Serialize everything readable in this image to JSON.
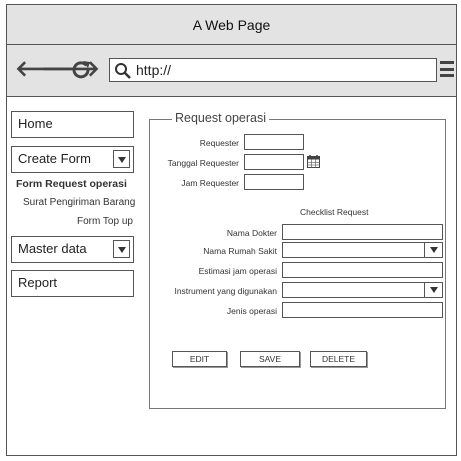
{
  "window": {
    "title": "A Web Page"
  },
  "toolbar": {
    "back_icon": "back-arrow-icon",
    "forward_icon": "forward-arrow-icon",
    "reload_icon": "reload-icon",
    "url": "http://",
    "menu_icon": "hamburger-menu-icon"
  },
  "sidebar": {
    "home": "Home",
    "create_form": "Create Form",
    "create_form_items": [
      "Form Request operasi",
      "Surat Pengiriman Barang",
      "Form Top up"
    ],
    "master_data": "Master data",
    "report": "Report"
  },
  "form": {
    "legend": "Request operasi",
    "requester_label": "Requester",
    "requester_value": "",
    "tanggal_label": "Tanggal Requester",
    "tanggal_value": "",
    "jam_label": "Jam Requester",
    "jam_value": "",
    "checklist_title": "Checklist Request",
    "nama_dokter_label": "Nama Dokter",
    "nama_dokter_value": "",
    "nama_rumah_sakit_label": "Nama Rumah Sakit",
    "nama_rumah_sakit_value": "",
    "estimasi_label": "Estimasi jam operasi",
    "estimasi_value": "",
    "instrument_label": "Instrument yang digunakan",
    "instrument_value": "",
    "jenis_label": "Jenis operasi",
    "jenis_value": "",
    "edit_button": "EDIT",
    "save_button": "SAVE",
    "delete_button": "DELETE"
  }
}
